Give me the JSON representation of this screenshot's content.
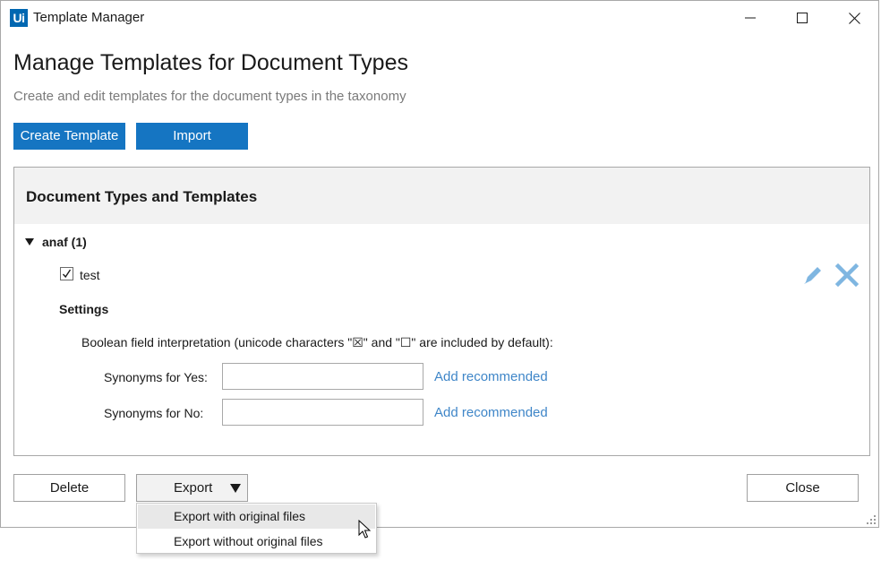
{
  "window": {
    "app_logo_text": "Ui",
    "title": "Template Manager"
  },
  "page": {
    "title": "Manage Templates for Document Types",
    "subtitle": "Create and edit templates for the document types in the taxonomy"
  },
  "toolbar": {
    "create_label": "Create Template",
    "import_label": "Import"
  },
  "panel": {
    "title": "Document Types and Templates",
    "document_type": {
      "label": "anaf (1)",
      "expanded": true,
      "template": {
        "name": "test",
        "checked": true
      }
    },
    "settings": {
      "label": "Settings",
      "boolean_description": "Boolean field interpretation (unicode characters \"☒\" and \"☐\" are included by default):",
      "yes_label": "Synonyms for Yes:",
      "yes_value": "",
      "no_label": "Synonyms for No:",
      "no_value": "",
      "add_recommended_label": "Add recommended"
    }
  },
  "footer": {
    "delete_label": "Delete",
    "export_label": "Export",
    "close_label": "Close"
  },
  "export_menu": {
    "items": [
      {
        "label": "Export with original files",
        "highlighted": true
      },
      {
        "label": "Export without original files",
        "highlighted": false
      }
    ]
  },
  "colors": {
    "primary": "#1575c2",
    "link": "#3f86c8",
    "icon_action": "#7fb6e1",
    "logo": "#0067b1"
  },
  "icons": [
    "app-logo",
    "minimize-icon",
    "maximize-icon",
    "close-icon",
    "expand-triangle-icon",
    "checkbox-check-icon",
    "pencil-icon",
    "x-icon",
    "dropdown-caret-icon",
    "mouse-cursor-icon",
    "resize-grip-icon"
  ]
}
